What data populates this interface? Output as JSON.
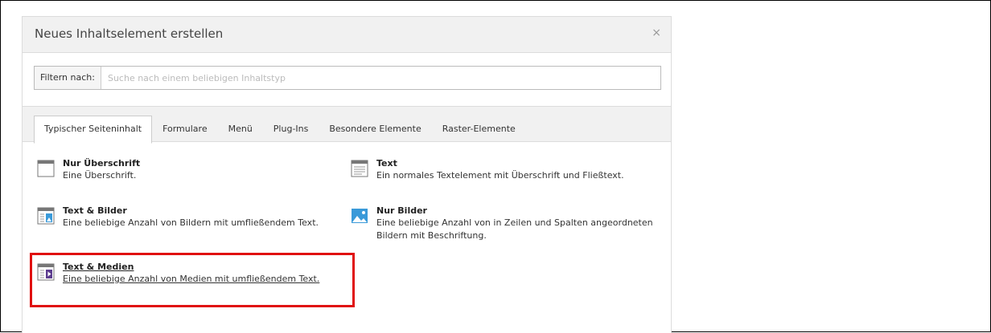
{
  "modal": {
    "title": "Neues Inhaltselement erstellen",
    "close_glyph": "×"
  },
  "filter": {
    "label": "Filtern nach:",
    "value": "",
    "placeholder": "Suche nach einem beliebigen Inhaltstyp"
  },
  "tabs": [
    {
      "label": "Typischer Seiteninhalt",
      "active": true
    },
    {
      "label": "Formulare",
      "active": false
    },
    {
      "label": "Menü",
      "active": false
    },
    {
      "label": "Plug-Ins",
      "active": false
    },
    {
      "label": "Besondere Elemente",
      "active": false
    },
    {
      "label": "Raster-Elemente",
      "active": false
    }
  ],
  "items": [
    {
      "name": "Nur Überschrift",
      "desc": "Eine Überschrift.",
      "icon": "header-icon"
    },
    {
      "name": "Text",
      "desc": "Ein normales Textelement mit Überschrift und Fließtext.",
      "icon": "text-icon"
    },
    {
      "name": "Text & Bilder",
      "desc": "Eine beliebige Anzahl von Bildern mit umfließendem Text.",
      "icon": "text-images-icon"
    },
    {
      "name": "Nur Bilder",
      "desc": "Eine beliebige Anzahl von in Zeilen und Spalten angeordneten Bildern mit Beschriftung.",
      "icon": "images-icon"
    },
    {
      "name": "Text & Medien",
      "desc": "Eine beliebige Anzahl von Medien mit umfließendem Text.",
      "icon": "text-media-icon"
    }
  ],
  "colors": {
    "highlight": "#e01010",
    "image_icon": "#3a9ad9",
    "media_icon": "#5c3d8f"
  }
}
